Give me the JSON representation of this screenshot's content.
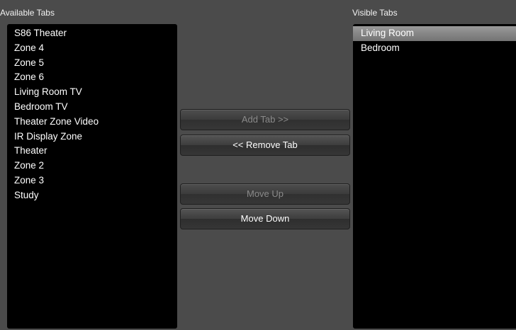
{
  "available": {
    "title": "Available Tabs",
    "items": [
      "S86 Theater",
      "Zone 4",
      "Zone 5",
      "Zone 6",
      "Living Room TV",
      "Bedroom TV",
      "Theater Zone Video",
      "IR Display Zone",
      "Theater",
      "Zone 2",
      "Zone 3",
      "Study"
    ]
  },
  "visible": {
    "title": "Visible Tabs",
    "items": [
      "Living Room",
      "Bedroom"
    ],
    "selected_index": 0
  },
  "buttons": {
    "add": {
      "label": "Add Tab >>",
      "enabled": false
    },
    "remove": {
      "label": "<< Remove Tab",
      "enabled": true
    },
    "move_up": {
      "label": "Move Up",
      "enabled": false
    },
    "move_down": {
      "label": "Move Down",
      "enabled": true
    }
  }
}
